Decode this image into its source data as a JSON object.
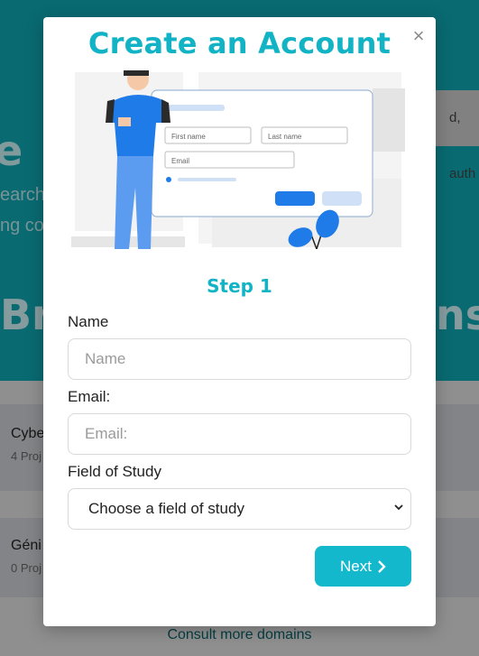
{
  "background": {
    "hero_letter": "e",
    "hero_line1": "earch",
    "hero_line2": "ng co",
    "hero_heading_left": "Br",
    "hero_heading_right": "ns",
    "chip_text": "d, auth",
    "cards": [
      {
        "title": "Cybe",
        "subtitle": "4 Proj"
      },
      {
        "title": "Géni",
        "subtitle": "0 Proj"
      }
    ],
    "consult_link": "Consult more domains"
  },
  "modal": {
    "title": "Create an Account",
    "close_glyph": "×",
    "illustration": {
      "first_name_label": "First name",
      "last_name_label": "Last name",
      "email_label": "Email"
    },
    "step_label": "Step 1",
    "fields": {
      "name_label": "Name",
      "name_placeholder": "Name",
      "email_label": "Email:",
      "email_placeholder": "Email:",
      "study_label": "Field of Study",
      "study_selected": "Choose a field of study"
    },
    "next_label": "Next",
    "next_icon": "chevron-right-icon"
  },
  "colors": {
    "accent": "#13b3c6",
    "hero_bg": "#0fa3ae",
    "button_bg": "#13b8cd"
  }
}
